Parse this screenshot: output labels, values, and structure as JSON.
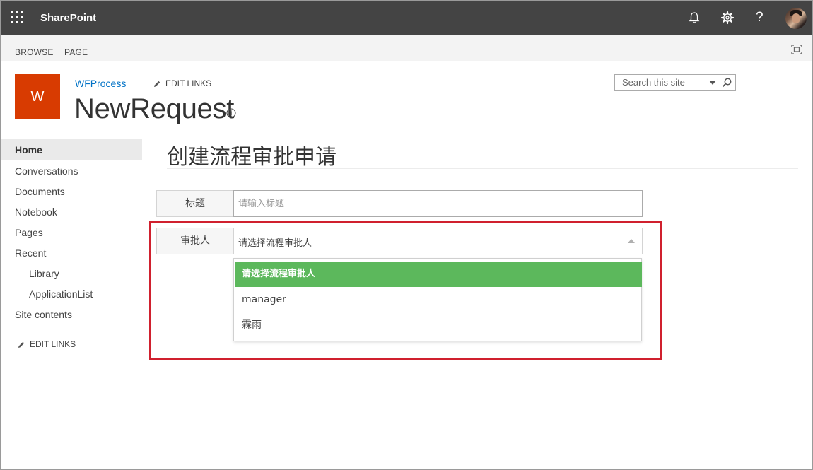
{
  "suite_bar": {
    "app_name": "SharePoint",
    "icons": [
      "app-launcher-icon",
      "bell-icon",
      "gear-icon",
      "help-icon",
      "avatar"
    ],
    "help_label": "?",
    "background_color": "#444444"
  },
  "ribbon": {
    "tabs": [
      "BROWSE",
      "PAGE"
    ]
  },
  "site_header": {
    "logo_letter": "W",
    "logo_color": "#d83b01",
    "site_link": "WFProcess",
    "edit_links": "EDIT LINKS",
    "site_title": "NewRequest",
    "search_placeholder": "Search this site"
  },
  "left_nav": {
    "items": [
      {
        "label": "Home"
      },
      {
        "label": "Conversations"
      },
      {
        "label": "Documents"
      },
      {
        "label": "Notebook"
      },
      {
        "label": "Pages"
      },
      {
        "label": "Recent"
      },
      {
        "label": "Library"
      },
      {
        "label": "ApplicationList"
      },
      {
        "label": "Site contents"
      }
    ],
    "edit_links": "EDIT LINKS"
  },
  "main": {
    "page_title": "创建流程审批申请",
    "form": {
      "title_label": "标题",
      "title_placeholder": "请输入标题",
      "approver_label": "审批人",
      "approver_value": "请选择流程审批人",
      "approver_options": [
        "请选择流程审批人",
        "manager",
        "霖雨"
      ],
      "selected_option_color": "#5cb85c"
    },
    "highlight_color": "#d0202e"
  }
}
